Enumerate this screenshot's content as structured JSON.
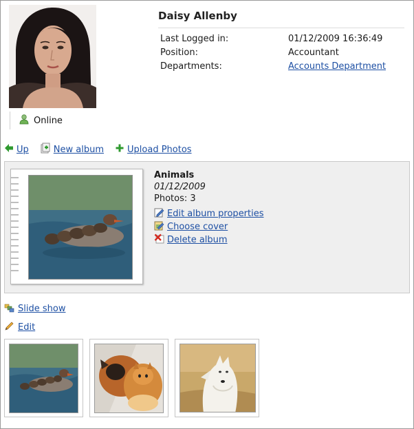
{
  "profile": {
    "name": "Daisy Allenby",
    "status": "Online",
    "fields": [
      {
        "label": "Last Logged in:",
        "value": "01/12/2009 16:36:49",
        "link": false
      },
      {
        "label": "Position:",
        "value": "Accountant",
        "link": false
      },
      {
        "label": "Departments:",
        "value": "Accounts Department",
        "link": true
      }
    ]
  },
  "toolbar": {
    "up_label": "Up",
    "new_album_label": "New album",
    "upload_label": "Upload Photos"
  },
  "album": {
    "title": "Animals",
    "date": "01/12/2009",
    "photos": "Photos: 3",
    "actions": {
      "edit": "Edit album properties",
      "cover": "Choose cover",
      "delete": "Delete album"
    }
  },
  "links": {
    "slideshow": "Slide show",
    "edit": "Edit"
  },
  "icons": {
    "up": "left-arrow-icon",
    "new_album": "new-album-icon",
    "upload": "plus-icon",
    "online": "user-online-icon",
    "edit_props": "edit-properties-icon",
    "choose_cover": "choose-cover-icon",
    "delete": "delete-icon",
    "slideshow": "slideshow-icon",
    "edit": "pencil-icon"
  },
  "colors": {
    "link": "#1d4fa3",
    "panel_bg": "#efefef",
    "accent_green": "#2f9a2f",
    "delete_red": "#d42a1f"
  }
}
